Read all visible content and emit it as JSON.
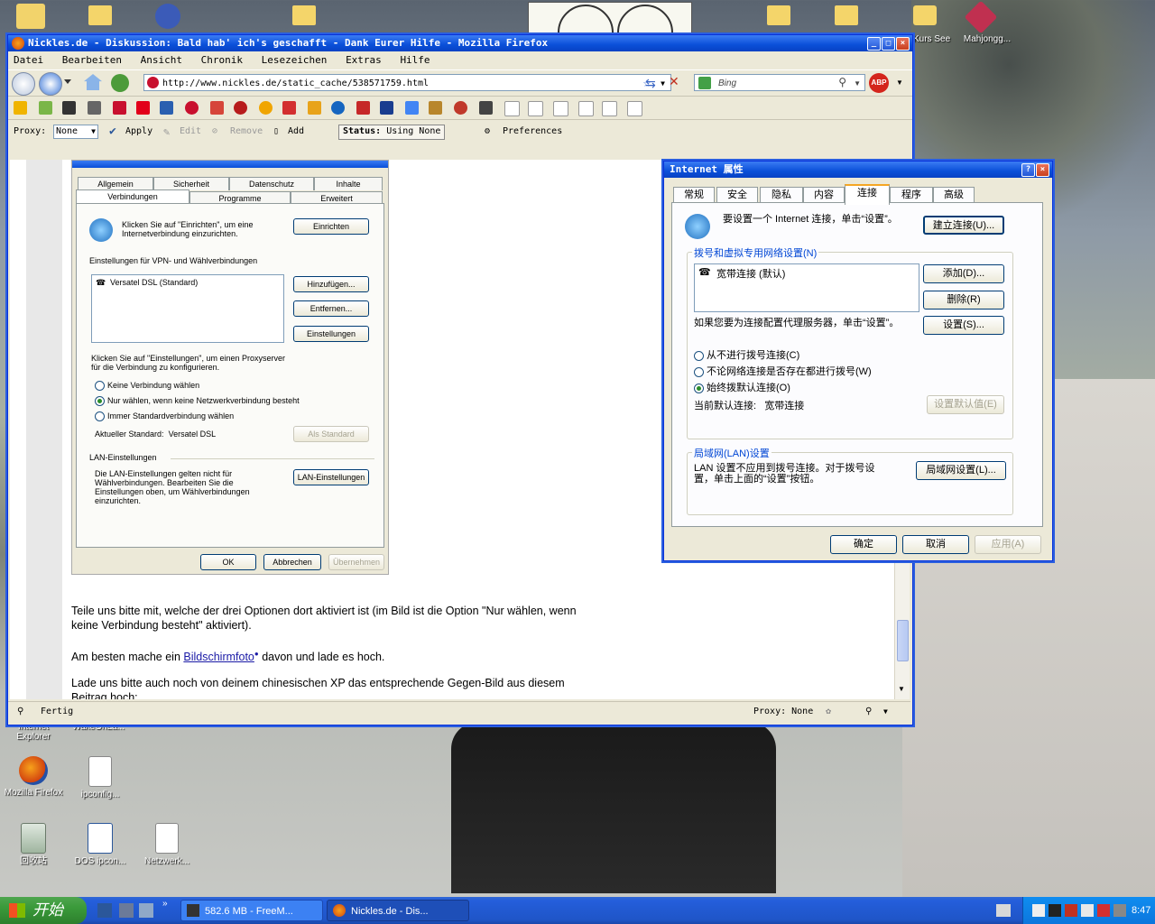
{
  "desktop": {
    "icons": [
      {
        "label": "Internet Explorer"
      },
      {
        "label": "WakeOnLa..."
      },
      {
        "label": "Mozilla Firefox"
      },
      {
        "label": "ipconfig..."
      },
      {
        "label": "回收站"
      },
      {
        "label": "DOS ipcon..."
      },
      {
        "label": "Netzwerk..."
      },
      {
        "label": "Kurs See"
      },
      {
        "label": "Mahjongg..."
      }
    ]
  },
  "firefox": {
    "title": "Nickles.de - Diskussion: Bald hab' ich's geschafft - Dank Eurer Hilfe - Mozilla Firefox",
    "menu": [
      "Datei",
      "Bearbeiten",
      "Ansicht",
      "Chronik",
      "Lesezeichen",
      "Extras",
      "Hilfe"
    ],
    "url": "http://www.nickles.de/static_cache/538571759.html",
    "search_placeholder": "Bing",
    "proxy": {
      "label": "Proxy:",
      "value": "None",
      "apply": "Apply",
      "edit": "Edit",
      "remove": "Remove",
      "add": "Add",
      "status_label": "Status:",
      "status_value": "Using None",
      "preferences": "Preferences"
    },
    "status": {
      "left": "Fertig",
      "proxy": "Proxy: None"
    },
    "content": {
      "para1": "Teile uns bitte mit, welche der drei Optionen dort aktiviert ist (im Bild ist die Option \"Nur wählen, wenn keine Verbindung besteht\" aktiviert).",
      "para2_pre": "Am besten mache ein ",
      "para2_link": "Bildschirmfoto",
      "para2_post": " davon und lade es hoch.",
      "para3": "Lade uns bitte auch noch von deinem chinesischen XP das entsprechende Gegen-Bild aus diesem Beitrag hoch:"
    },
    "screenshot": {
      "tabs_row1": [
        "Allgemein",
        "Sicherheit",
        "Datenschutz",
        "Inhalte"
      ],
      "tabs_row2": [
        "Verbindungen",
        "Programme",
        "Erweitert"
      ],
      "setup_text": "Klicken Sie auf \"Einrichten\", um eine Internetverbindung einzurichten.",
      "einrichten": "Einrichten",
      "vpn_label": "Einstellungen für VPN- und Wählverbindungen",
      "list_item": "Versatel DSL (Standard)",
      "hinzufuegen": "Hinzufügen...",
      "entfernen": "Entfernen...",
      "einstellungen": "Einstellungen",
      "proxy_text": "Klicken Sie auf \"Einstellungen\", um einen Proxyserver für die Verbindung zu konfigurieren.",
      "radio1": "Keine Verbindung wählen",
      "radio2": "Nur wählen, wenn keine Netzwerkverbindung besteht",
      "radio3": "Immer Standardverbindung wählen",
      "current_label": "Aktueller Standard:",
      "current_value": "Versatel DSL",
      "als_standard": "Als Standard",
      "lan_label": "LAN-Einstellungen",
      "lan_text": "Die LAN-Einstellungen gelten nicht für Wählverbindungen. Bearbeiten Sie die Einstellungen oben, um Wählverbindungen einzurichten.",
      "lan_button": "LAN-Einstellungen",
      "ok": "OK",
      "abbrechen": "Abbrechen",
      "uebernehmen": "Übernehmen"
    }
  },
  "ie_dialog": {
    "title": "Internet 属性",
    "tabs": [
      "常规",
      "安全",
      "隐私",
      "内容",
      "连接",
      "程序",
      "高级"
    ],
    "setup_text": "要设置一个 Internet 连接，单击“设置”。",
    "setup_button": "建立连接(U)...",
    "dial_group": "拨号和虚拟专用网络设置(N)",
    "list_item": "宽带连接 (默认)",
    "add": "添加(D)...",
    "delete": "删除(R)",
    "settings_text": "如果您要为连接配置代理服务器，单击“设置”。",
    "settings": "设置(S)...",
    "radio1": "从不进行拨号连接(C)",
    "radio2": "不论网络连接是否存在都进行拨号(W)",
    "radio3": "始终拨默认连接(O)",
    "current_label": "当前默认连接:",
    "current_value": "宽带连接",
    "set_default": "设置默认值(E)",
    "lan_group": "局域网(LAN)设置",
    "lan_text": "LAN 设置不应用到拨号连接。对于拨号设置，单击上面的“设置”按钮。",
    "lan_button": "局域网设置(L)...",
    "ok": "确定",
    "cancel": "取消",
    "apply": "应用(A)"
  },
  "taskbar": {
    "start": "开始",
    "tasks": [
      "582.6 MB - FreeM...",
      "Nickles.de - Dis..."
    ],
    "time": "8:47"
  }
}
